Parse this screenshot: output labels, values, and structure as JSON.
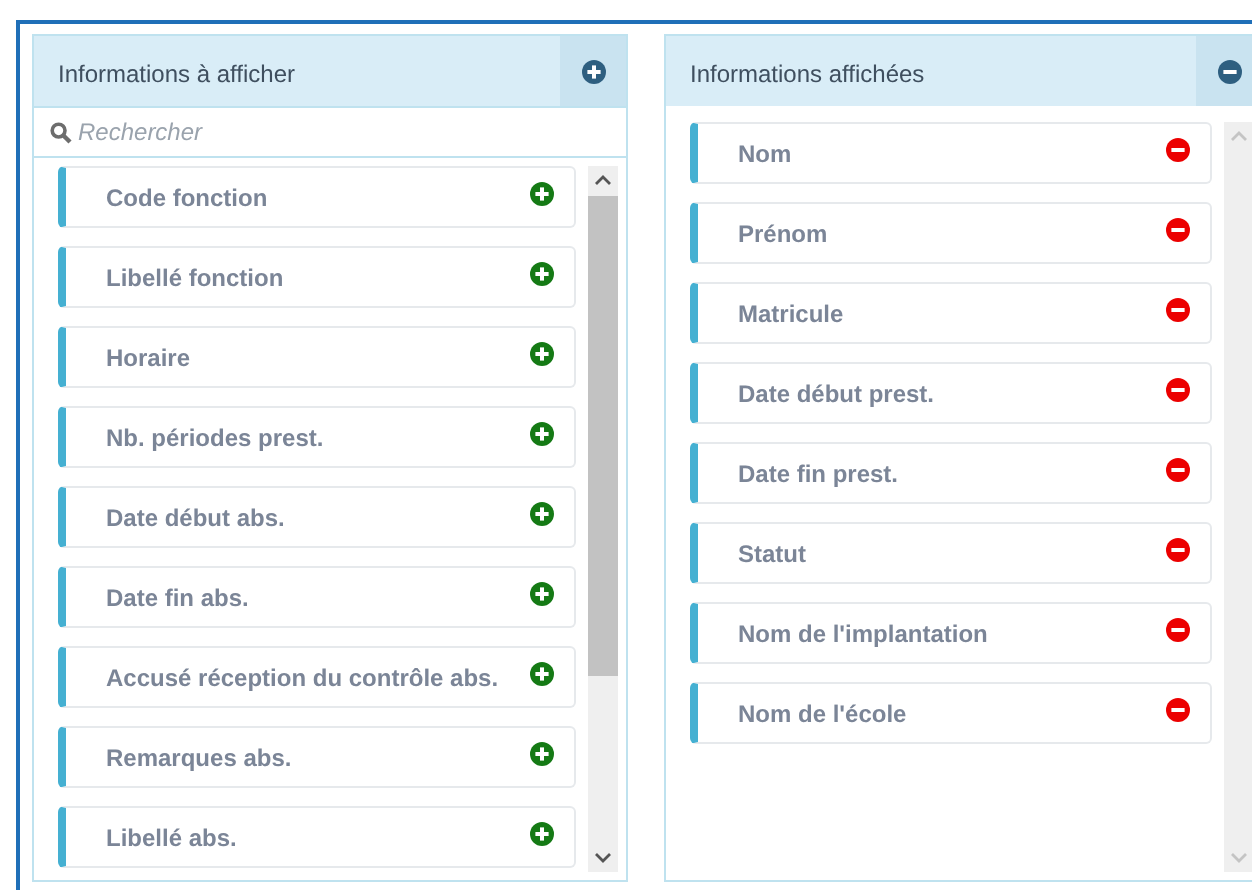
{
  "panels": [
    {
      "title": "Informations à afficher",
      "header_button": {
        "kind": "add"
      },
      "search": {
        "placeholder": "Rechercher"
      },
      "scroll_thumb": true,
      "items": [
        {
          "label": "Code fonction",
          "kind": "add"
        },
        {
          "label": "Libellé fonction",
          "kind": "add"
        },
        {
          "label": "Horaire",
          "kind": "add"
        },
        {
          "label": "Nb. périodes prest.",
          "kind": "add"
        },
        {
          "label": "Date début abs.",
          "kind": "add"
        },
        {
          "label": "Date fin abs.",
          "kind": "add"
        },
        {
          "label": "Accusé réception du contrôle abs.",
          "kind": "add"
        },
        {
          "label": "Remarques abs.",
          "kind": "add"
        },
        {
          "label": "Libellé abs.",
          "kind": "add"
        }
      ]
    },
    {
      "title": "Informations affichées",
      "header_button": {
        "kind": "remove"
      },
      "scroll_thumb": false,
      "items": [
        {
          "label": "Nom",
          "kind": "remove"
        },
        {
          "label": "Prénom",
          "kind": "remove"
        },
        {
          "label": "Matricule",
          "kind": "remove"
        },
        {
          "label": "Date début prest.",
          "kind": "remove"
        },
        {
          "label": "Date fin prest.",
          "kind": "remove"
        },
        {
          "label": "Statut",
          "kind": "remove"
        },
        {
          "label": "Nom de l'implantation",
          "kind": "remove"
        },
        {
          "label": "Nom de l'école",
          "kind": "remove"
        }
      ]
    }
  ]
}
